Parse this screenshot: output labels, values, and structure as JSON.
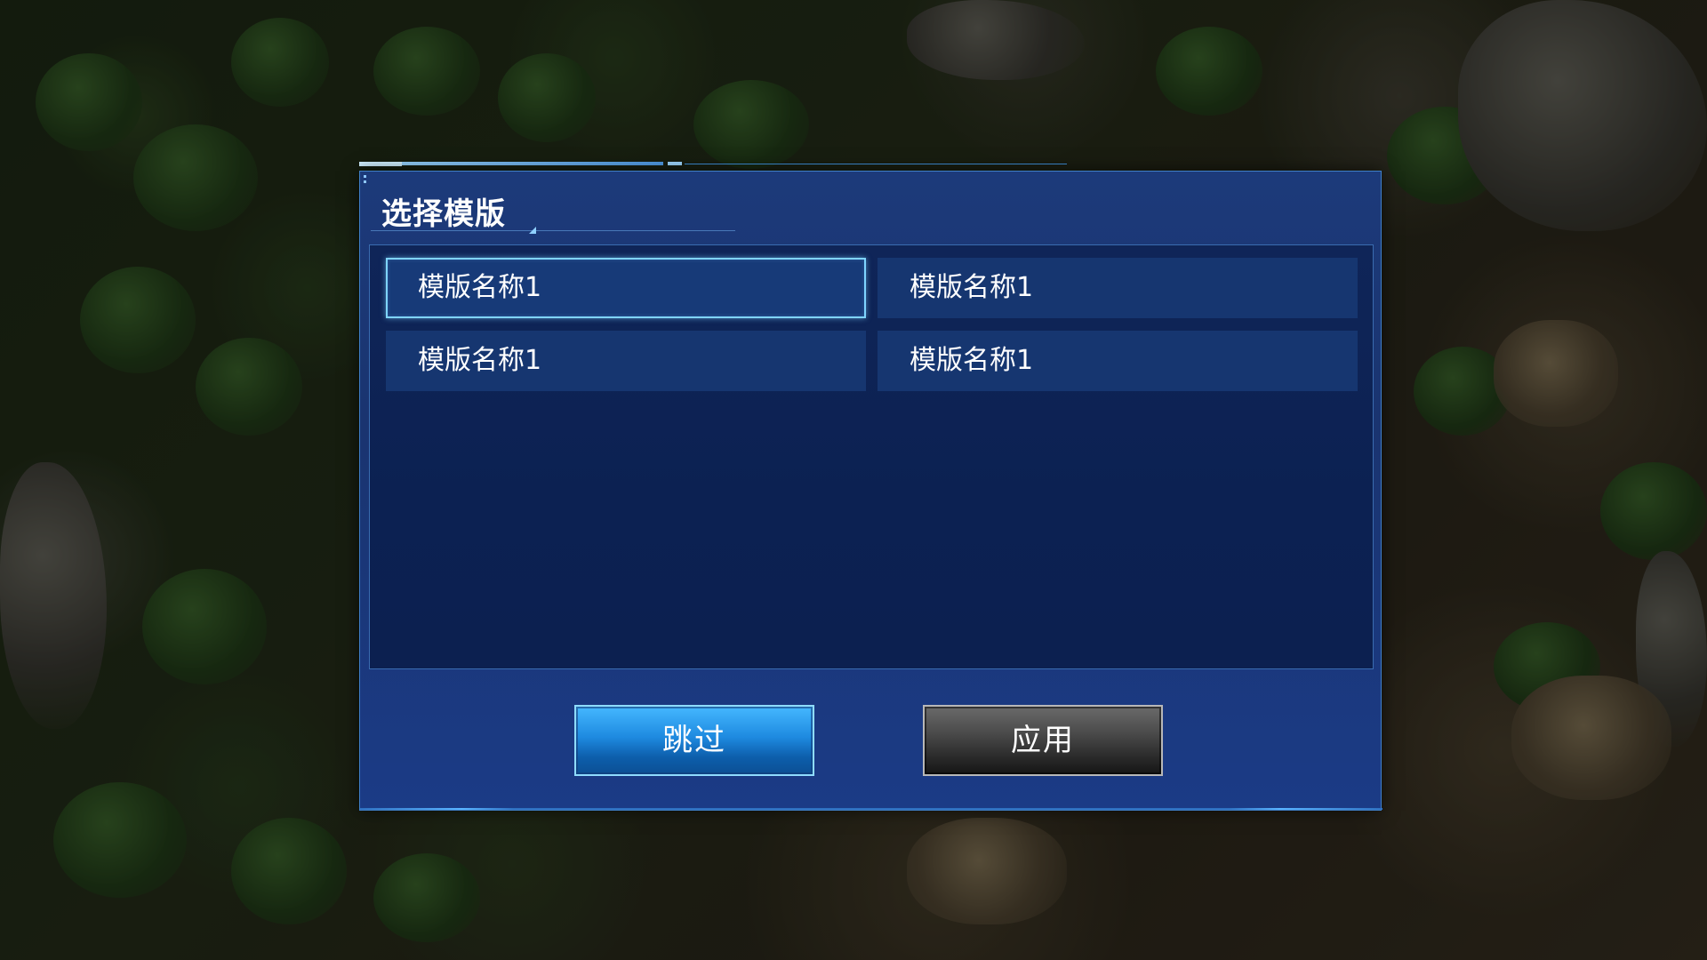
{
  "dialog": {
    "title": "选择模版",
    "templates": [
      {
        "label": "模版名称1",
        "selected": true
      },
      {
        "label": "模版名称1",
        "selected": false
      },
      {
        "label": "模版名称1",
        "selected": false
      },
      {
        "label": "模版名称1",
        "selected": false
      }
    ],
    "buttons": {
      "skip_label": "跳过",
      "apply_label": "应用"
    }
  },
  "colors": {
    "dialog_bg": "#1c3a7a",
    "list_bg": "#0f2558",
    "item_bg": "#163670",
    "selected_border": "#7fd4ff",
    "skip_button": "#1e8ae0",
    "apply_button": "#4a4a4a"
  }
}
